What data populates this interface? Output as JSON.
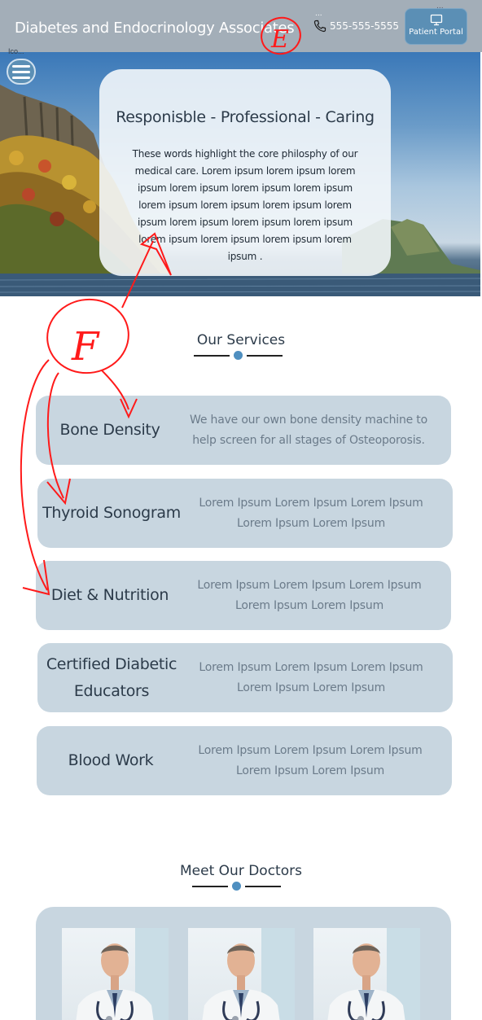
{
  "header": {
    "site_title": "Diabetes and Endocrinology Associates",
    "phone_number": "555-555-5555",
    "phone_dots": "...",
    "portal_label": "Patient Portal",
    "portal_dots": "..."
  },
  "hero": {
    "icon_label": "Ico...",
    "heading": "Responisble - Professional - Caring",
    "body": "These words highlight the core philosphy of our medical care.  Lorem ipsum lorem ipsum lorem ipsum lorem ipsum lorem ipsum lorem ipsum lorem ipsum lorem ipsum lorem ipsum lorem ipsum lorem ipsum lorem ipsum lorem ipsum lorem ipsum lorem ipsum lorem ipsum lorem ipsum ."
  },
  "services": {
    "title": "Our Services",
    "items": [
      {
        "name": "Bone Density",
        "description": "We have our own bone density machine to help screen for all stages of Osteoporosis."
      },
      {
        "name": "Thyroid Sonogram",
        "description": "Lorem Ipsum Lorem Ipsum Lorem Ipsum Lorem Ipsum Lorem Ipsum"
      },
      {
        "name": "Diet & Nutrition",
        "description": "Lorem Ipsum Lorem Ipsum Lorem Ipsum Lorem Ipsum Lorem Ipsum"
      },
      {
        "name": "Certified Diabetic Educators",
        "description": "Lorem Ipsum Lorem Ipsum Lorem Ipsum Lorem Ipsum Lorem Ipsum"
      },
      {
        "name": "Blood Work",
        "description": "Lorem Ipsum Lorem Ipsum Lorem Ipsum Lorem Ipsum Lorem Ipsum"
      }
    ]
  },
  "doctors": {
    "title": "Meet Our Doctors"
  },
  "annotations": {
    "mark_e": "E",
    "mark_f": "F"
  },
  "colors": {
    "header_bg": "#a3aeb8",
    "accent": "#5b8fb5",
    "card_bg": "#c8d6e0",
    "annotation_red": "#ff1a1a"
  }
}
